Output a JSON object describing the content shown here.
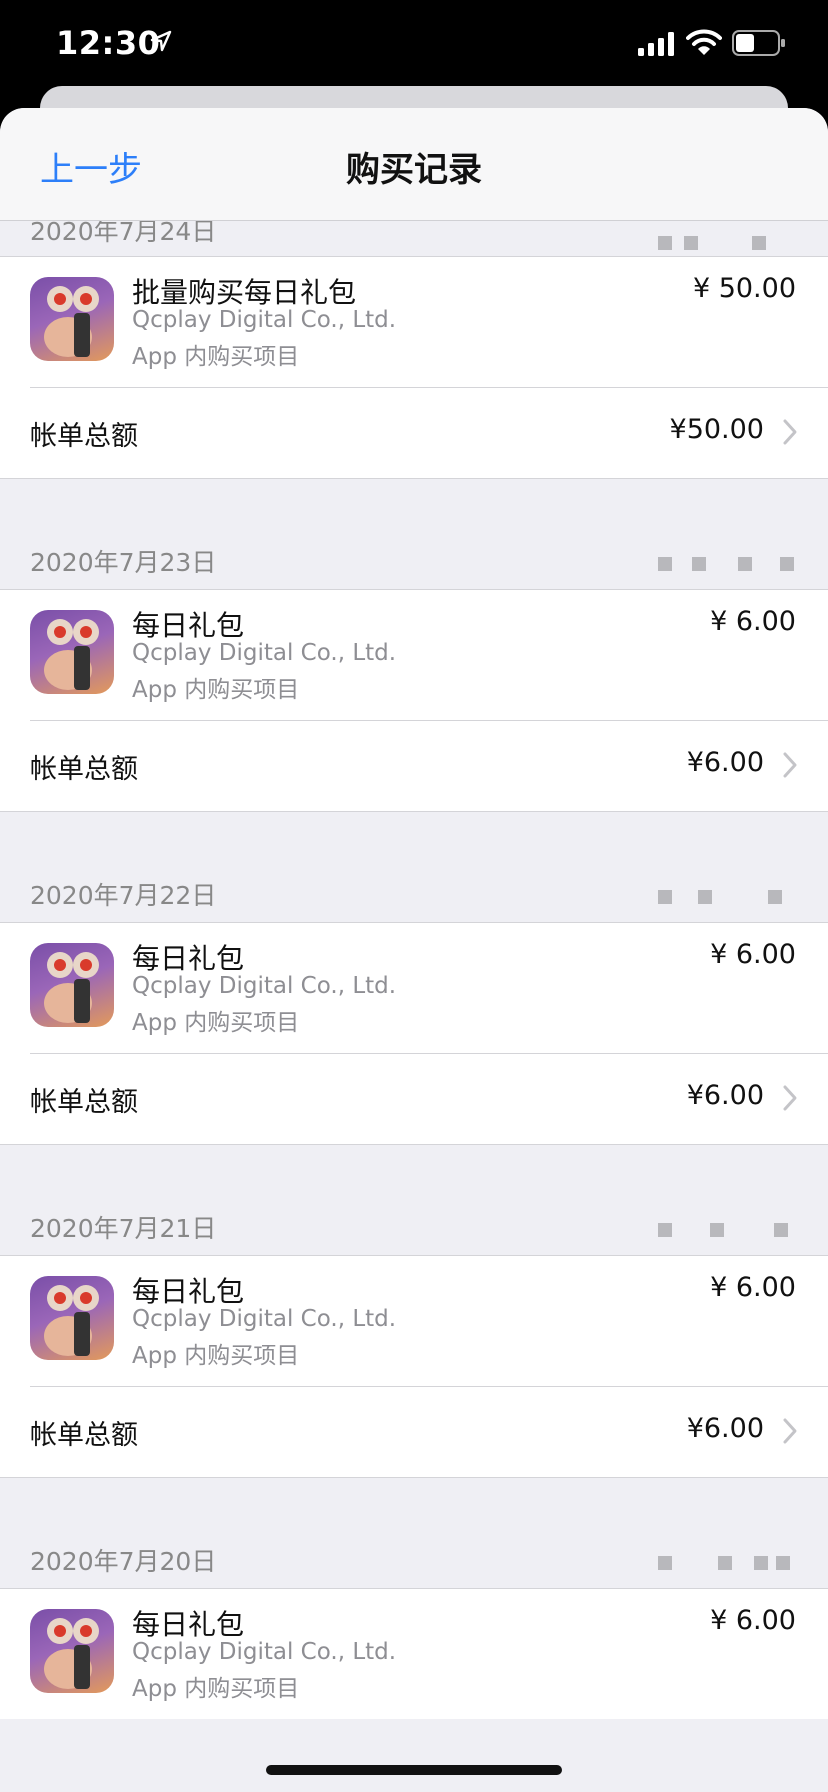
{
  "status_bar": {
    "time": "12:30"
  },
  "nav": {
    "back_label": "上一步",
    "title": "购买记录"
  },
  "total_label": "帐单总额",
  "groups": [
    {
      "date": "2020年7月24日",
      "items": [
        {
          "title": "批量购买每日礼包",
          "developer": "Qcplay Digital Co., Ltd.",
          "type": "App 内购买项目",
          "price": "¥ 50.00"
        }
      ],
      "total": "¥50.00"
    },
    {
      "date": "2020年7月23日",
      "items": [
        {
          "title": "每日礼包",
          "developer": "Qcplay Digital Co., Ltd.",
          "type": "App 内购买项目",
          "price": "¥ 6.00"
        }
      ],
      "total": "¥6.00"
    },
    {
      "date": "2020年7月22日",
      "items": [
        {
          "title": "每日礼包",
          "developer": "Qcplay Digital Co., Ltd.",
          "type": "App 内购买项目",
          "price": "¥ 6.00"
        }
      ],
      "total": "¥6.00"
    },
    {
      "date": "2020年7月21日",
      "items": [
        {
          "title": "每日礼包",
          "developer": "Qcplay Digital Co., Ltd.",
          "type": "App 内购买项目",
          "price": "¥ 6.00"
        }
      ],
      "total": "¥6.00"
    },
    {
      "date": "2020年7月20日",
      "items": [
        {
          "title": "每日礼包",
          "developer": "Qcplay Digital Co., Ltd.",
          "type": "App 内购买项目",
          "price": "¥ 6.00"
        }
      ]
    }
  ],
  "colors": {
    "accent": "#2d7ff9",
    "background": "#efeff4",
    "secondary_text": "#8e8e93"
  }
}
